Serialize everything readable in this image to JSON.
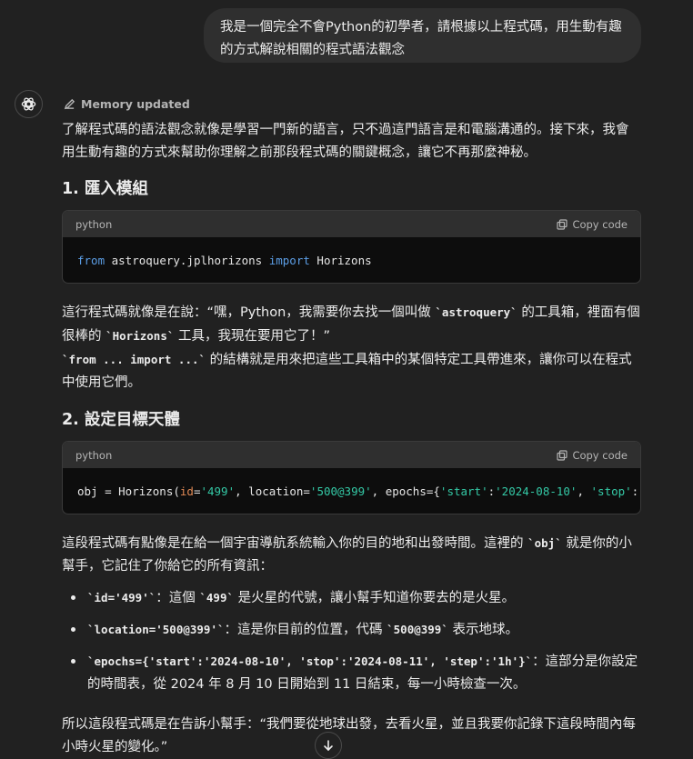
{
  "user_message": "我是一個完全不會Python的初學者，請根據以上程式碼，用生動有趣的方式解說相關的程式語法觀念",
  "memory_label": "Memory updated",
  "intro": "了解程式碼的語法觀念就像是學習一門新的語言，只不過這門語言是和電腦溝通的。接下來，我會用生動有趣的方式來幫助你理解之前那段程式碼的關鍵概念，讓它不再那麼神秘。",
  "section1": {
    "heading": "1. 匯入模組",
    "code_lang": "python",
    "copy_label": "Copy code",
    "code": {
      "kw1": "from",
      "module": " astroquery.jplhorizons ",
      "kw2": "import",
      "name": " Horizons"
    },
    "p1_a": "這行程式碼就像是在說：“嘿，Python，我需要你去找一個叫做",
    "p1_code1": "`astroquery`",
    "p1_b": "的工具箱，裡面有個很棒的",
    "p1_code2": "`Horizons`",
    "p1_c": "工具，我現在要用它了！”",
    "p2_code": "`from ... import ...`",
    "p2_text": "的結構就是用來把這些工具箱中的某個特定工具帶進來，讓你可以在程式中使用它們。"
  },
  "section2": {
    "heading": "2. 設定目標天體",
    "code_lang": "python",
    "copy_label": "Copy code",
    "code": {
      "t1": "obj = Horizons(",
      "a1": "id",
      "t2": "=",
      "s1": "'499'",
      "t3": ", location=",
      "s2": "'500@399'",
      "t4": ", epochs={",
      "s3": "'start'",
      "t5": ":",
      "s4": "'2024-08-10'",
      "t6": ", ",
      "s5": "'stop'",
      "t7": ":"
    },
    "p1_a": "這段程式碼有點像是在給一個宇宙導航系統輸入你的目的地和出發時間。這裡的",
    "p1_code": "`obj`",
    "p1_b": "就是你的小幫手，它記住了你給它的所有資訊：",
    "bullets": [
      {
        "code": "`id='499'`",
        "text_a": "：這個",
        "code2": "`499`",
        "text_b": "是火星的代號，讓小幫手知道你要去的是火星。"
      },
      {
        "code": "`location='500@399'`",
        "text_a": "：這是你目前的位置，代碼",
        "code2": "`500@399`",
        "text_b": "表示地球。"
      },
      {
        "code": "`epochs={'start':'2024-08-10', 'stop':'2024-08-11', 'step':'1h'}`",
        "text_a": "：這部分是你設定的時間表，從 2024 年 8 月 10 日開始到 11 日結束，每一小時檢查一次。",
        "code2": "",
        "text_b": ""
      }
    ],
    "conclusion": "所以這段程式碼是在告訴小幫手：“我們要從地球出發，去看火星，並且我要你記錄下這段時間內每小時火星的變化。”"
  }
}
